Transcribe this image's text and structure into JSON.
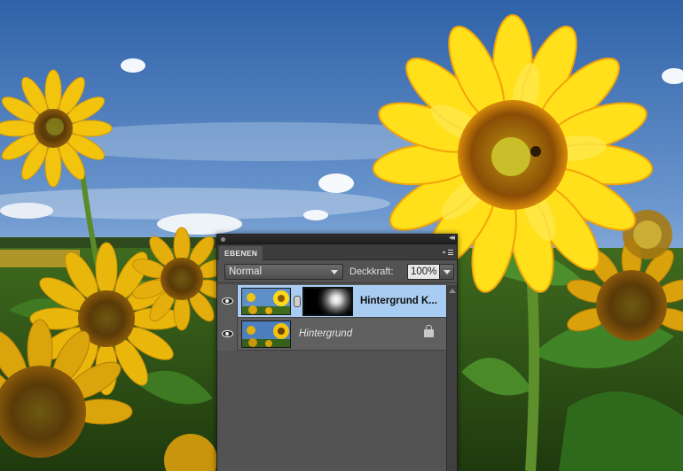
{
  "panel": {
    "tab_label": "EBENEN",
    "collapse_glyph": "◂◂",
    "menu_glyph": "▾",
    "blend_mode": "Normal",
    "opacity_label": "Deckkraft:",
    "opacity_value": "100%"
  },
  "layers": [
    {
      "name": "Hintergrund K...",
      "selected": true,
      "visible": true,
      "has_mask": true
    },
    {
      "name": "Hintergrund",
      "selected": false,
      "visible": true,
      "locked": true
    }
  ],
  "icons": {
    "visibility": "eye-icon",
    "link": "chain-link-icon",
    "lock": "lock-icon",
    "panel_menu": "panel-menu-icon"
  },
  "colors": {
    "sky": "#3a6fb0",
    "panel_bg": "#535353",
    "selection": "#a9cdf2",
    "sunflower": "#f2c40e"
  }
}
